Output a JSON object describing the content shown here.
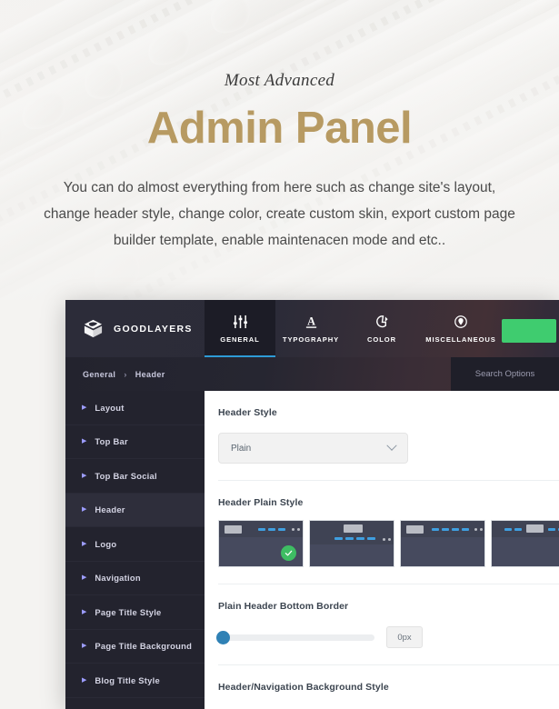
{
  "hero": {
    "eyebrow": "Most Advanced",
    "title": "Admin Panel",
    "description": "You can do almost everything from here such as change site's layout, change header style, change color, create custom skin, export custom page builder template, enable maintenacen mode and etc..",
    "title_color": "#b79a62"
  },
  "panel": {
    "brand_name": "GOODLAYERS",
    "brand_icon": "goodlayers-logo-icon",
    "save_button_color": "#3fcc6f",
    "active_tab_accent": "#2e9bd6",
    "tabs": [
      {
        "label": "GENERAL",
        "icon": "sliders-icon",
        "active": true
      },
      {
        "label": "TYPOGRAPHY",
        "icon": "underlined-a-icon",
        "active": false
      },
      {
        "label": "COLOR",
        "icon": "paint-drop-icon",
        "active": false
      },
      {
        "label": "MISCELLANEOUS",
        "icon": "circle-pin-icon",
        "active": false
      }
    ],
    "breadcrumb": {
      "parent": "General",
      "separator": "›",
      "current": "Header"
    },
    "search": {
      "placeholder": "Search Options",
      "value": "Search Options"
    },
    "sidebar": [
      {
        "label": "Layout",
        "active": false
      },
      {
        "label": "Top Bar",
        "active": false
      },
      {
        "label": "Top Bar Social",
        "active": false
      },
      {
        "label": "Header",
        "active": true
      },
      {
        "label": "Logo",
        "active": false
      },
      {
        "label": "Navigation",
        "active": false
      },
      {
        "label": "Page Title Style",
        "active": false
      },
      {
        "label": "Page Title Background",
        "active": false
      },
      {
        "label": "Blog Title Style",
        "active": false
      }
    ],
    "fields": {
      "header_style": {
        "label": "Header Style",
        "value": "Plain"
      },
      "header_plain_style": {
        "label": "Header Plain Style",
        "options": [
          {
            "name": "logo-left-nav-right",
            "selected": true
          },
          {
            "name": "logo-center-nav-below",
            "selected": false
          },
          {
            "name": "logo-left-nav-inline",
            "selected": false
          },
          {
            "name": "logo-center-nav-split",
            "selected": false
          }
        ]
      },
      "plain_header_bottom_border": {
        "label": "Plain Header Bottom Border",
        "value": "0px",
        "slider_percent": 0,
        "handle_color": "#2f81b5"
      },
      "header_nav_background_style": {
        "label": "Header/Navigation Background Style"
      }
    }
  }
}
